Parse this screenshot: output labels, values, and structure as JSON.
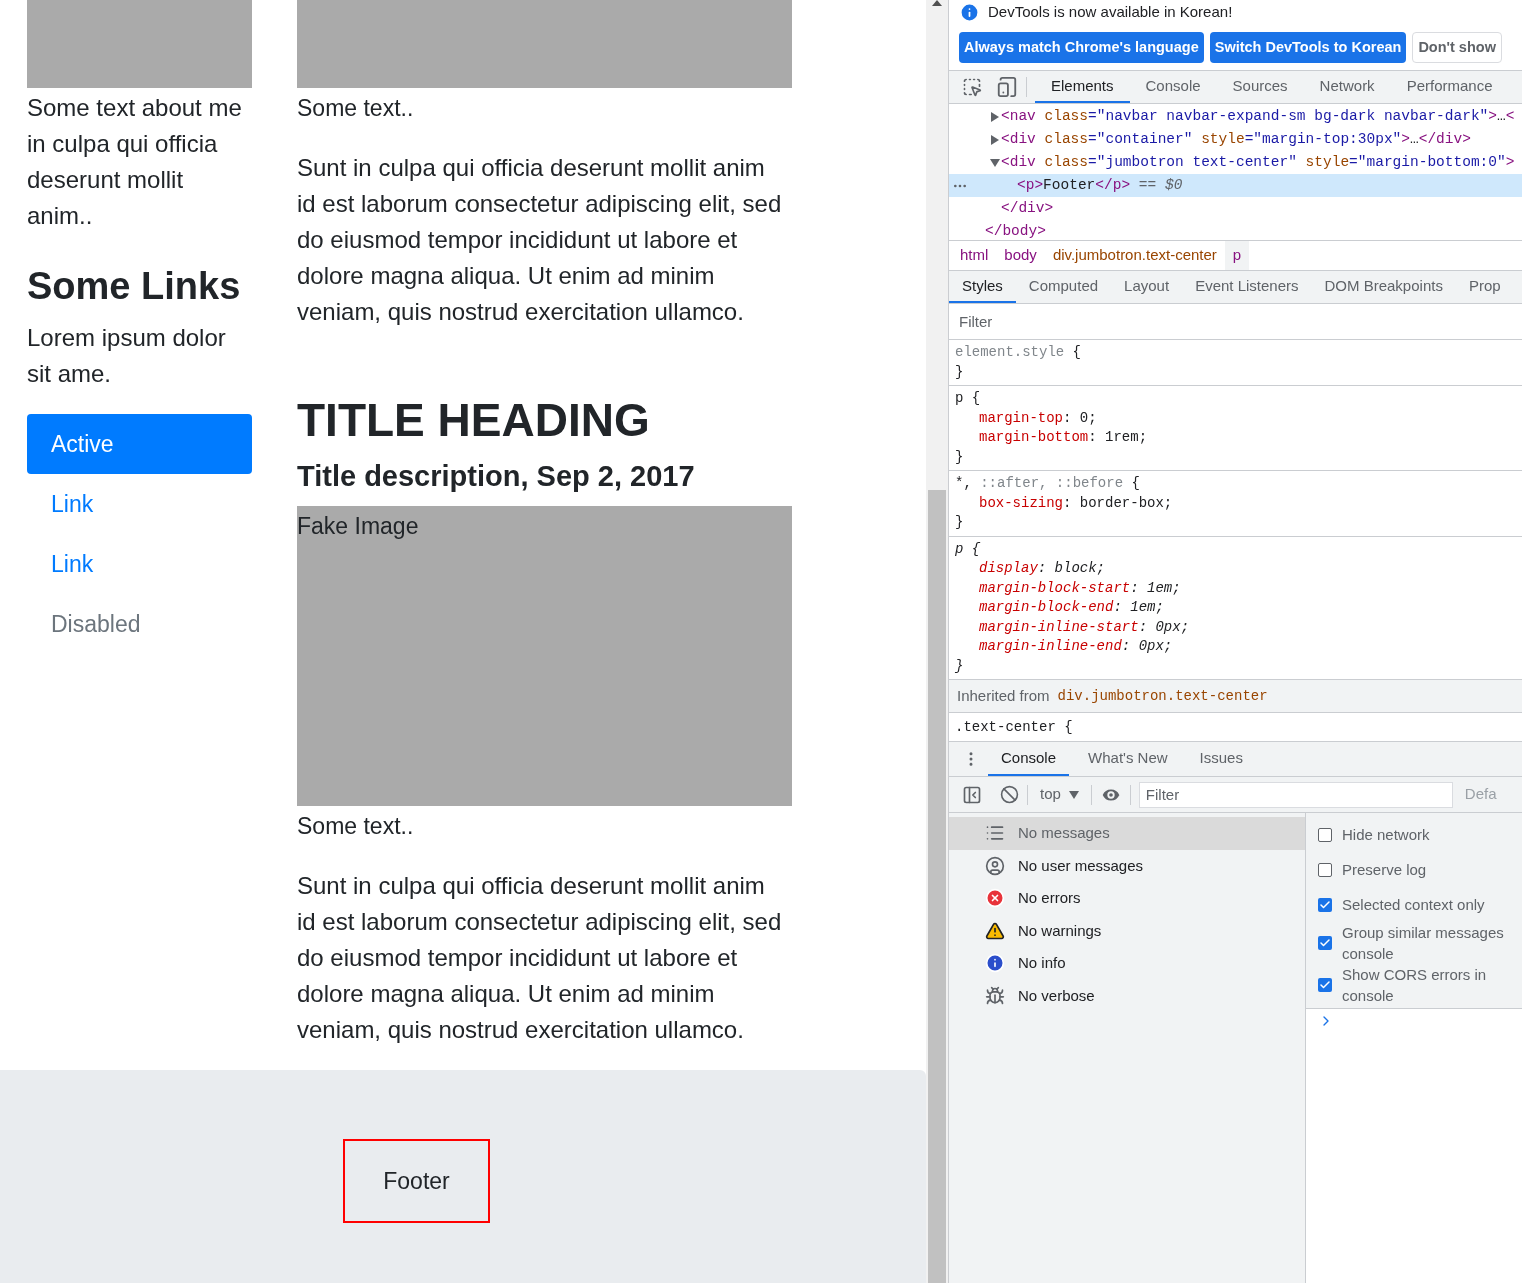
{
  "page": {
    "sidebar": {
      "about_text": "Some text about me in culpa qui officia deserunt mollit anim..",
      "links_heading": "Some Links",
      "links_text": "Lorem ipsum dolor sit ame.",
      "nav": [
        {
          "label": "Active",
          "selected": true,
          "disabled": false
        },
        {
          "label": "Link",
          "selected": false,
          "disabled": false
        },
        {
          "label": "Link",
          "selected": false,
          "disabled": false
        },
        {
          "label": "Disabled",
          "selected": false,
          "disabled": true
        }
      ]
    },
    "main": {
      "top_caption": "Some text..",
      "top_paragraph": "Sunt in culpa qui officia deserunt mollit anim id est laborum consectetur adipiscing elit, sed do eiusmod tempor incididunt ut labore et dolore magna aliqua. Ut enim ad minim veniam, quis nostrud exercitation ullamco.",
      "title": "TITLE HEADING",
      "description": "Title description, Sep 2, 2017",
      "fake_image_label": "Fake Image",
      "caption": "Some text..",
      "paragraph": "Sunt in culpa qui officia deserunt mollit anim id est laborum consectetur adipiscing elit, sed do eiusmod tempor incididunt ut labore et dolore magna aliqua. Ut enim ad minim veniam, quis nostrud exercitation ullamco."
    },
    "footer": {
      "text": "Footer"
    }
  },
  "devtools": {
    "notice": {
      "message": "DevTools is now available in Korean!",
      "buttons": [
        {
          "label": "Always match Chrome's language",
          "kind": "primary"
        },
        {
          "label": "Switch DevTools to Korean",
          "kind": "primary"
        },
        {
          "label": "Don't show",
          "kind": "secondary"
        }
      ]
    },
    "tabs": [
      {
        "label": "Elements",
        "selected": true
      },
      {
        "label": "Console",
        "selected": false
      },
      {
        "label": "Sources",
        "selected": false
      },
      {
        "label": "Network",
        "selected": false
      },
      {
        "label": "Performance",
        "selected": false
      }
    ],
    "dom_tree": {
      "children": [
        {
          "expanded": false,
          "selected": false,
          "parts": [
            {
              "kind": "tag",
              "text": "<nav "
            },
            {
              "kind": "attr",
              "text": "class"
            },
            {
              "kind": "value",
              "text": "=\"navbar navbar-expand-sm bg-dark navbar-dark\""
            },
            {
              "kind": "tag",
              "text": ">"
            },
            {
              "kind": "text",
              "text": "…"
            },
            {
              "kind": "tag",
              "text": "<"
            }
          ]
        },
        {
          "expanded": false,
          "selected": false,
          "parts": [
            {
              "kind": "tag",
              "text": "<div "
            },
            {
              "kind": "attr",
              "text": "class"
            },
            {
              "kind": "value",
              "text": "=\"container\" "
            },
            {
              "kind": "attr",
              "text": "style"
            },
            {
              "kind": "value",
              "text": "=\"margin-top:30px\""
            },
            {
              "kind": "tag",
              "text": ">"
            },
            {
              "kind": "text",
              "text": "…"
            },
            {
              "kind": "tag",
              "text": "</div>"
            }
          ]
        },
        {
          "expanded": true,
          "selected": false,
          "parts": [
            {
              "kind": "tag",
              "text": "<div "
            },
            {
              "kind": "attr",
              "text": "class"
            },
            {
              "kind": "value",
              "text": "=\"jumbotron text-center\" "
            },
            {
              "kind": "attr",
              "text": "style"
            },
            {
              "kind": "value",
              "text": "=\"margin-bottom:0\""
            },
            {
              "kind": "tag",
              "text": ">"
            }
          ],
          "children": [
            {
              "selected": true,
              "parts": [
                {
                  "kind": "tag",
                  "text": "<p>"
                },
                {
                  "kind": "text",
                  "text": "Footer"
                },
                {
                  "kind": "tag",
                  "text": "</p>"
                }
              ],
              "suffix": "== $0"
            }
          ],
          "closing": [
            {
              "kind": "tag",
              "text": "</div>"
            }
          ]
        }
      ],
      "closing": [
        {
          "kind": "tag",
          "text": "</body>"
        }
      ]
    },
    "breadcrumbs": [
      {
        "label": "html",
        "selected": false
      },
      {
        "label": "body",
        "selected": false
      },
      {
        "label": "div.jumbotron.text-center",
        "selected": false
      },
      {
        "label": "p",
        "selected": true
      }
    ],
    "style_tabs": [
      {
        "label": "Styles",
        "selected": true
      },
      {
        "label": "Computed",
        "selected": false
      },
      {
        "label": "Layout",
        "selected": false
      },
      {
        "label": "Event Listeners",
        "selected": false
      },
      {
        "label": "DOM Breakpoints",
        "selected": false
      },
      {
        "label": "Prop",
        "selected": false
      }
    ],
    "filter_placeholder": "Filter",
    "rules": [
      {
        "agent": false,
        "selector": [
          {
            "kind": "dim",
            "text": "element.style"
          },
          {
            "kind": "plain",
            "text": " {"
          }
        ],
        "close": "}"
      },
      {
        "agent": false,
        "selector": [
          {
            "kind": "plain",
            "text": "p {"
          }
        ],
        "declarations": [
          {
            "name": "margin-top",
            "rest": ": 0;"
          },
          {
            "name": "margin-bottom",
            "rest": ": 1rem;"
          }
        ],
        "close": "}"
      },
      {
        "agent": false,
        "selector": [
          {
            "kind": "plain",
            "text": "*, "
          },
          {
            "kind": "dim",
            "text": "::after, ::before"
          },
          {
            "kind": "plain",
            "text": " {"
          }
        ],
        "declarations": [
          {
            "name": "box-sizing",
            "rest": ": border-box;"
          }
        ],
        "close": "}"
      },
      {
        "agent": true,
        "selector": [
          {
            "kind": "plain",
            "text": "p {"
          }
        ],
        "declarations": [
          {
            "name": "display",
            "rest": ": block;"
          },
          {
            "name": "margin-block-start",
            "rest": ": 1em;"
          },
          {
            "name": "margin-block-end",
            "rest": ": 1em;"
          },
          {
            "name": "margin-inline-start",
            "rest": ": 0px;"
          },
          {
            "name": "margin-inline-end",
            "rest": ": 0px;"
          }
        ],
        "close": "}"
      }
    ],
    "inherited": {
      "label": "Inherited from",
      "source": "div.jumbotron.text-center"
    },
    "inherited_rule": ".text-center {",
    "drawer_tabs": [
      {
        "label": "Console",
        "selected": true
      },
      {
        "label": "What's New",
        "selected": false
      },
      {
        "label": "Issues",
        "selected": false
      }
    ],
    "console_toolbar": {
      "context": "top",
      "filter_placeholder": "Filter",
      "levels": "Defa"
    },
    "message_filters": [
      {
        "kind": "all",
        "label": "No messages",
        "selected": true
      },
      {
        "kind": "user",
        "label": "No user messages",
        "selected": false
      },
      {
        "kind": "error",
        "label": "No errors",
        "selected": false
      },
      {
        "kind": "warning",
        "label": "No warnings",
        "selected": false
      },
      {
        "kind": "info",
        "label": "No info",
        "selected": false
      },
      {
        "kind": "verbose",
        "label": "No verbose",
        "selected": false
      }
    ],
    "settings": [
      {
        "label": "Hide network",
        "checked": false
      },
      {
        "label": "Preserve log",
        "checked": false
      },
      {
        "label": "Selected context only",
        "checked": true
      },
      {
        "label": "Group similar messages console",
        "checked": true
      },
      {
        "label": "Show CORS errors in console",
        "checked": true
      }
    ]
  }
}
